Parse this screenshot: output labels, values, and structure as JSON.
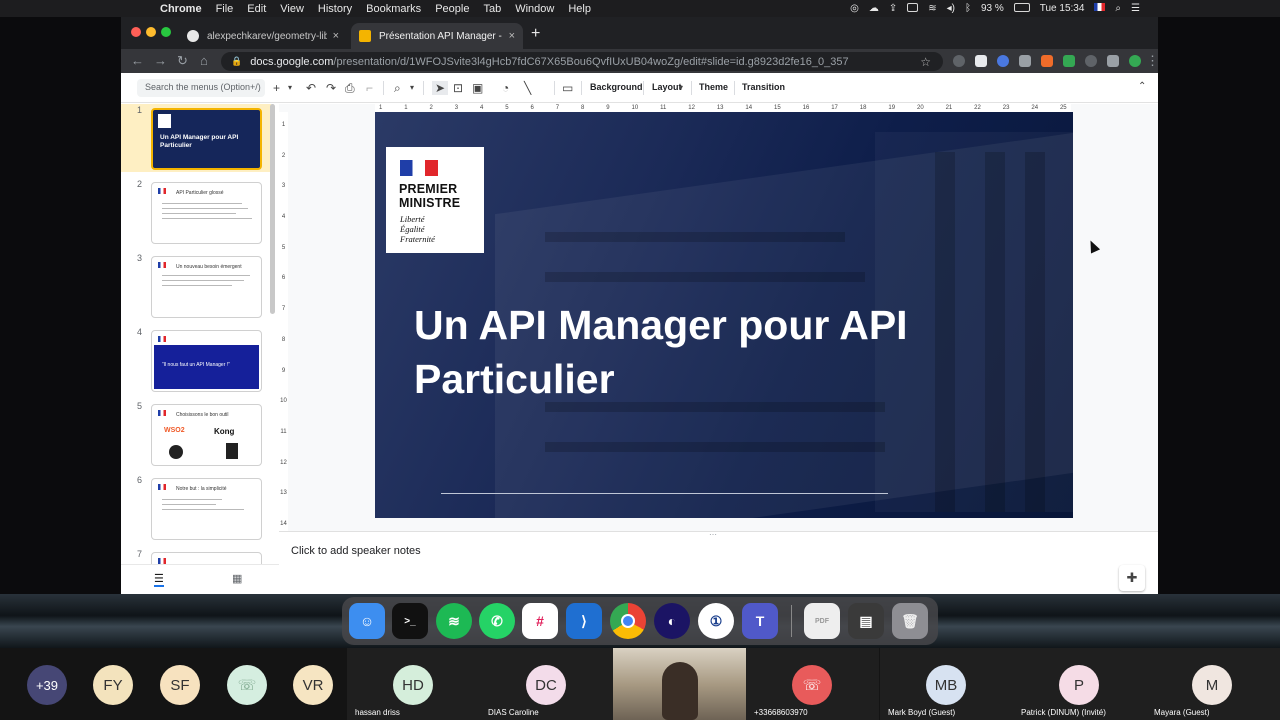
{
  "menubar": {
    "app_name": "Chrome",
    "items": [
      "File",
      "Edit",
      "View",
      "History",
      "Bookmarks",
      "People",
      "Tab",
      "Window",
      "Help"
    ],
    "battery": "93 %",
    "clock": "Tue 15:34"
  },
  "tabs": [
    {
      "title": "alexpechkarev/geometry-library",
      "close": "×",
      "icon": "github-icon"
    },
    {
      "title": "Présentation API Manager - Goo",
      "close": "×",
      "icon": "google-slides-icon"
    }
  ],
  "new_tab_label": "+",
  "address": {
    "host": "docs.google.com",
    "path": "/presentation/d/1WFOJSvite3l4gHcb7fdC67X65Bou6QvfIUxUB04woZg/edit#slide=id.g8923d2fe16_0_357"
  },
  "toolbar": {
    "search_placeholder": "Search the menus (Option+/)",
    "background": "Background",
    "layout": "Layout",
    "theme": "Theme",
    "transition": "Transition"
  },
  "ruler": {
    "h": [
      "1",
      "1",
      "2",
      "3",
      "4",
      "5",
      "6",
      "7",
      "8",
      "9",
      "10",
      "11",
      "12",
      "13",
      "14",
      "15",
      "16",
      "17",
      "18",
      "19",
      "20",
      "21",
      "22",
      "23",
      "24",
      "25"
    ],
    "v": [
      "1",
      "2",
      "3",
      "4",
      "5",
      "6",
      "7",
      "8",
      "9",
      "10",
      "11",
      "12",
      "13",
      "14"
    ]
  },
  "slides": [
    {
      "num": "1",
      "title": "Un API Manager pour API Particulier"
    },
    {
      "num": "2",
      "title": "API Particulier glossé"
    },
    {
      "num": "3",
      "title": "Un nouveau besoin émergent"
    },
    {
      "num": "4",
      "title": "“Il nous faut un API Manager !”"
    },
    {
      "num": "5",
      "title": "Choisissons le bon outil"
    },
    {
      "num": "6",
      "title": "Notre but : la simplicité"
    },
    {
      "num": "7",
      "title": ""
    }
  ],
  "thumb5_logos": {
    "wso2": "WSO2",
    "kong": "Kong"
  },
  "current_slide": {
    "logo": {
      "line1": "PREMIER",
      "line2": "MINISTRE",
      "motto1": "Liberté",
      "motto2": "Égalité",
      "motto3": "Fraternité"
    },
    "title_line1": "Un API Manager pour API",
    "title_line2": "Particulier"
  },
  "speaker_notes_placeholder": "Click to add speaker notes",
  "participants": {
    "overflow_count": "+39",
    "avatars": [
      {
        "initials": "FY",
        "color": "#f3e3bd"
      },
      {
        "initials": "SF",
        "color": "#f7e2bf"
      },
      {
        "initials": "",
        "color": "#d5eee0"
      },
      {
        "initials": "VR",
        "color": "#f6e5c2"
      }
    ],
    "tiles": [
      {
        "initials": "HD",
        "name": "hassan driss",
        "color": "#d5eedb"
      },
      {
        "initials": "DC",
        "name": "DIAS Caroline",
        "color": "#f3dcea"
      },
      {
        "initials": "",
        "name": "+33668603970",
        "color": "#e85b5b"
      },
      {
        "initials": "MB",
        "name": "Mark Boyd (Guest)",
        "color": "#d7e2f1"
      },
      {
        "initials": "P",
        "name": "Patrick (DINUM) (Invité)",
        "color": "#f5dce6"
      },
      {
        "initials": "M",
        "name": "Mayara (Guest)",
        "color": "#f0e6e0"
      }
    ]
  },
  "dock_apps": [
    "Finder",
    "Terminal",
    "Spotify",
    "WhatsApp",
    "Slack",
    "Visual Studio Code",
    "Chrome",
    "Firefox",
    "1Password",
    "Teams",
    "PDF",
    "Screenshot",
    "Trash"
  ]
}
